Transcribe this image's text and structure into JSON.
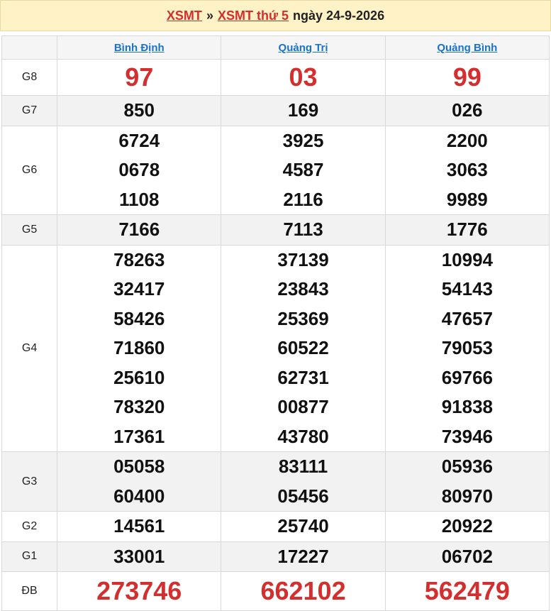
{
  "header": {
    "link1": "XSMT",
    "separator": "»",
    "link2": "XSMT thứ 5",
    "date_text": "ngày 24-9-2026"
  },
  "provinces": [
    "Bình Định",
    "Quảng Trị",
    "Quảng Bình"
  ],
  "rows": [
    {
      "label": "G8",
      "values": [
        [
          "97"
        ],
        [
          "03"
        ],
        [
          "99"
        ]
      ]
    },
    {
      "label": "G7",
      "values": [
        [
          "850"
        ],
        [
          "169"
        ],
        [
          "026"
        ]
      ]
    },
    {
      "label": "G6",
      "values": [
        [
          "6724",
          "0678",
          "1108"
        ],
        [
          "3925",
          "4587",
          "2116"
        ],
        [
          "2200",
          "3063",
          "9989"
        ]
      ]
    },
    {
      "label": "G5",
      "values": [
        [
          "7166"
        ],
        [
          "7113"
        ],
        [
          "1776"
        ]
      ]
    },
    {
      "label": "G4",
      "values": [
        [
          "78263",
          "32417",
          "58426",
          "71860",
          "25610",
          "78320",
          "17361"
        ],
        [
          "37139",
          "23843",
          "25369",
          "60522",
          "62731",
          "00877",
          "43780"
        ],
        [
          "10994",
          "54143",
          "47657",
          "79053",
          "69766",
          "91838",
          "73946"
        ]
      ]
    },
    {
      "label": "G3",
      "values": [
        [
          "05058",
          "60400"
        ],
        [
          "83111",
          "05456"
        ],
        [
          "05936",
          "80970"
        ]
      ]
    },
    {
      "label": "G2",
      "values": [
        [
          "14561"
        ],
        [
          "25740"
        ],
        [
          "20922"
        ]
      ]
    },
    {
      "label": "G1",
      "values": [
        [
          "33001"
        ],
        [
          "17227"
        ],
        [
          "06702"
        ]
      ]
    },
    {
      "label": "ĐB",
      "values": [
        [
          "273746"
        ],
        [
          "662102"
        ],
        [
          "562479"
        ]
      ]
    }
  ],
  "colors": {
    "header_bg": "#fff2c7",
    "accent_red": "#d32f2f",
    "link_blue": "#1a73c9"
  }
}
